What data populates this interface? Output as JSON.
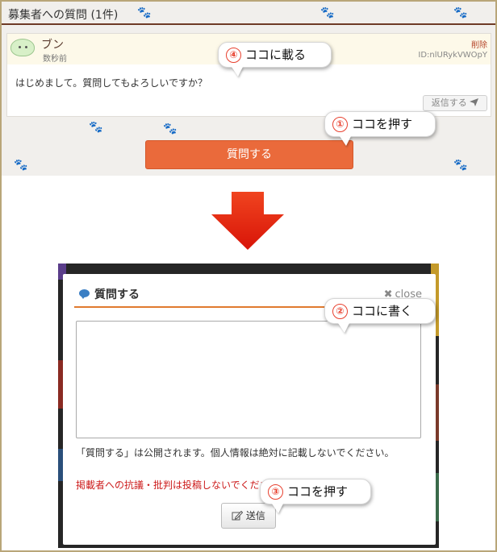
{
  "top_panel": {
    "header": "募集者への質問 (1件)",
    "question": {
      "username": "ブン",
      "posted_time": "数秒前",
      "delete_label": "削除",
      "user_id": "ID:nlURykVWOpY",
      "text": "はじめまして。質問してもよろしいですか？",
      "reply_label": "返信する"
    },
    "ask_button_label": "質問する"
  },
  "modal": {
    "title": "質問する",
    "close_label": "close",
    "notice": "「質問する」は公開されます。個人情報は絶対に記載しないでください。",
    "warning": "掲載者への抗議・批判は投稿しないでください。",
    "submit_label": "送信"
  },
  "callouts": [
    {
      "num": "④",
      "text": "ココに載る"
    },
    {
      "num": "①",
      "text": "ココを押す"
    },
    {
      "num": "②",
      "text": "ココに書く"
    },
    {
      "num": "③",
      "text": "ココを押す"
    }
  ],
  "colors": {
    "accent_orange": "#ea6a3b",
    "arrow_red": "#e41b0f",
    "warning_red": "#cc1a1a",
    "header_rule": "#6e3a26"
  },
  "icons": [
    "paw-icon",
    "avatar-icon",
    "paper-plane-icon",
    "down-arrow-icon",
    "chat-bubble-icon",
    "close-icon",
    "pencil-icon"
  ]
}
